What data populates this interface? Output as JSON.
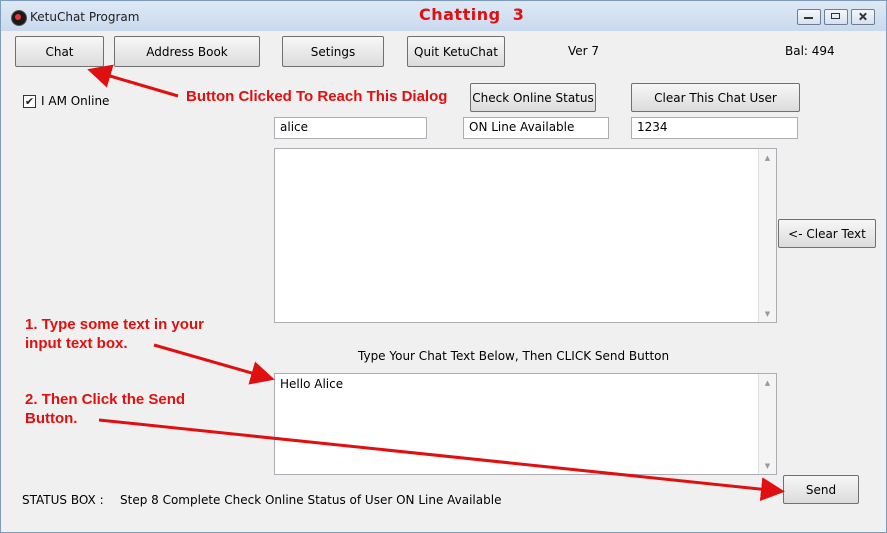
{
  "window": {
    "title": "KetuChat Program",
    "heading": "Chatting  3",
    "controls": [
      "minimize",
      "maximize",
      "close"
    ]
  },
  "toolbar": {
    "chat_label": "Chat",
    "address_book_label": "Address Book",
    "settings_label": "Setings",
    "quit_label": "Quit KetuChat",
    "version": "Ver 7",
    "balance": "Bal: 494"
  },
  "online": {
    "checked": true,
    "label": "I AM Online"
  },
  "buttons": {
    "check_status": "Check Online Status",
    "clear_user": "Clear This Chat User",
    "clear_text": "<- Clear Text",
    "send": "Send"
  },
  "fields": {
    "user_name": "alice",
    "online_status": "ON Line Available",
    "user_id": "1234"
  },
  "chat": {
    "history": "",
    "input_prompt": "Type Your Chat Text Below, Then CLICK Send Button",
    "input_value": "Hello Alice"
  },
  "status": {
    "label": "STATUS BOX :",
    "text": "Step 8 Complete Check Online Status of User ON Line Available"
  },
  "annotations": {
    "button_clicked": "Button Clicked To Reach This Dialog",
    "step1_line1": "1.  Type some text in your",
    "step1_line2": "input text box.",
    "step2_line1": "2.  Then Click the Send",
    "step2_line2": "Button.",
    "color": "#e01010"
  },
  "icons": {
    "app": "ketuchat-app-icon",
    "check": "✔",
    "scroll_up": "▲",
    "scroll_down": "▼"
  }
}
